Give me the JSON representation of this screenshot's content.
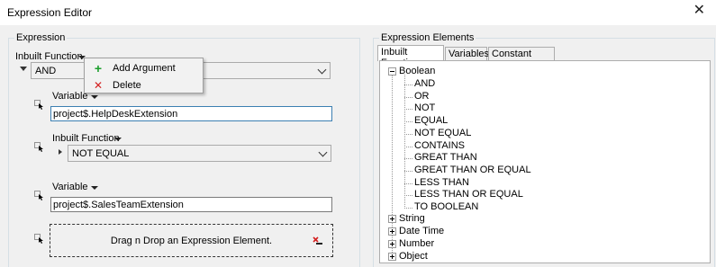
{
  "window": {
    "title": "Expression Editor",
    "close_glyph": "✕"
  },
  "left": {
    "group_title": "Expression",
    "root_caption": "Inbuilt Function",
    "root_value": "AND",
    "var1": {
      "caption": "Variable",
      "value": "project$.HelpDeskExtension"
    },
    "func": {
      "caption": "Inbuilt Function",
      "value": "NOT EQUAL"
    },
    "var2": {
      "caption": "Variable",
      "value": "project$.SalesTeamExtension"
    },
    "dropzone_text": "Drag n Drop an Expression Element."
  },
  "context_menu": {
    "items": [
      {
        "label": "Add Argument",
        "icon": "plus-icon",
        "color": "#1a9e2a"
      },
      {
        "label": "Delete",
        "icon": "red-x-icon",
        "color": "#d42020"
      }
    ]
  },
  "right": {
    "group_title": "Expression Elements",
    "tabs": [
      "Inbuilt Functions",
      "Variables",
      "Constant Values"
    ],
    "active_tab": "Inbuilt Functions",
    "tree": {
      "expanded": "Boolean",
      "boolean_children": [
        "AND",
        "OR",
        "NOT",
        "EQUAL",
        "NOT EQUAL",
        "CONTAINS",
        "GREAT THAN",
        "GREAT THAN OR EQUAL",
        "LESS THAN",
        "LESS THAN OR EQUAL",
        "TO BOOLEAN"
      ],
      "collapsed": [
        "String",
        "Date Time",
        "Number",
        "Object"
      ]
    }
  }
}
